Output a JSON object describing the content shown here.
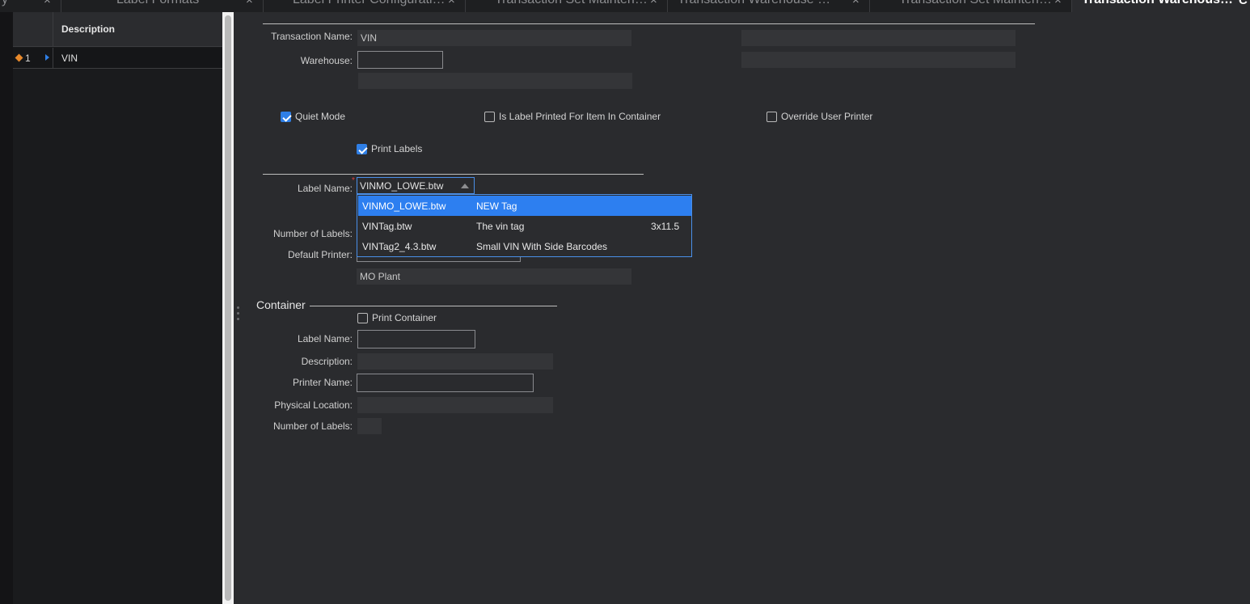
{
  "tabs": [
    {
      "label": "y",
      "close": "×"
    },
    {
      "label": "Label Formats",
      "close": "×"
    },
    {
      "label": "Label Printer Configurati…",
      "close": "×"
    },
    {
      "label": "Transaction Set Mainten…",
      "close": "×"
    },
    {
      "label": "Transaction Warehouse …",
      "close": "×"
    },
    {
      "label": "Transaction Set Mainten…",
      "close": "×"
    },
    {
      "label": "Transaction Warehous…",
      "close": "C"
    }
  ],
  "grid": {
    "header_description": "Description",
    "rows": [
      {
        "num": "1",
        "description": "VIN"
      }
    ]
  },
  "form": {
    "transaction_name_label": "Transaction Name:",
    "transaction_name_value": "VIN",
    "warehouse_label": "Warehouse:",
    "warehouse_value": "",
    "quiet_mode_label": "Quiet Mode",
    "quiet_mode_checked": true,
    "is_label_printed_label": "Is Label Printed For Item In Container",
    "is_label_printed_checked": false,
    "override_user_printer_label": "Override User Printer",
    "override_user_printer_checked": false,
    "print_labels_label": "Print Labels",
    "print_labels_checked": true,
    "label_name_label": "Label Name:",
    "label_name_value": "VINMO_LOWE.btw",
    "number_of_labels_label": "Number of Labels:",
    "default_printer_label": "Default Printer:",
    "plant_value": "MO Plant"
  },
  "dropdown": {
    "options": [
      {
        "name": "VINMO_LOWE.btw",
        "description": "NEW Tag",
        "size": "",
        "selected": true
      },
      {
        "name": "VINTag.btw",
        "description": "The vin tag",
        "size": "3x11.5",
        "selected": false
      },
      {
        "name": "VINTag2_4.3.btw",
        "description": "Small VIN With Side Barcodes",
        "size": "",
        "selected": false
      }
    ]
  },
  "container": {
    "title": "Container",
    "print_container_label": "Print Container",
    "print_container_checked": false,
    "label_name_label": "Label Name:",
    "description_label": "Description:",
    "printer_name_label": "Printer Name:",
    "physical_location_label": "Physical Location:",
    "number_of_labels_label": "Number of Labels:"
  },
  "colors": {
    "accent": "#2d7ff0",
    "background": "#2a2b2e",
    "row_marker": "#e8892b"
  }
}
